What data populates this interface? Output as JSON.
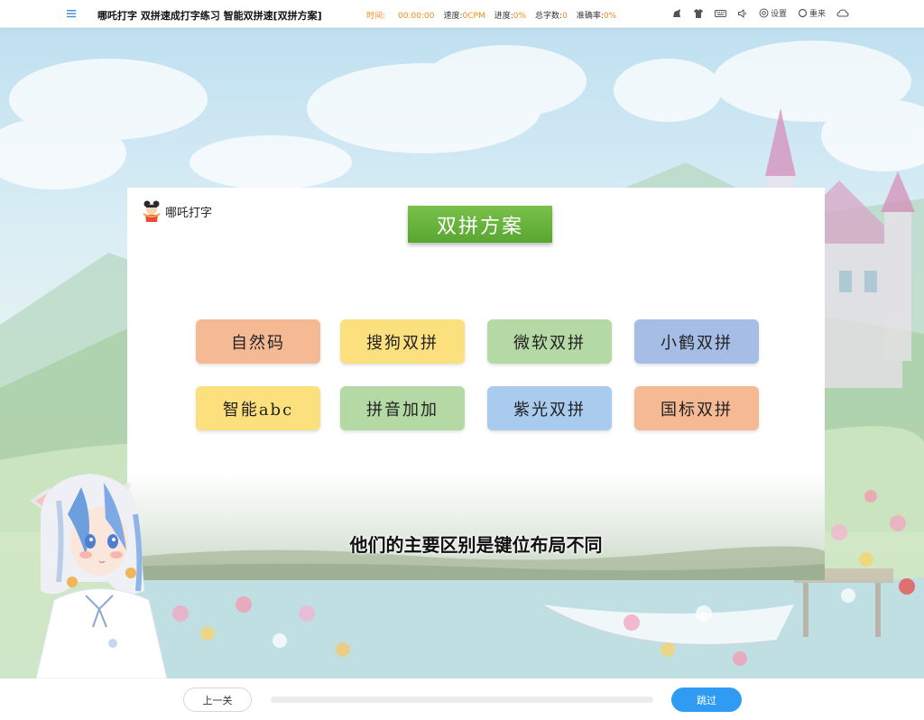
{
  "topbar": {
    "title": "哪吒打字 双拼速成打字练习 智能双拼速[双拼方案]",
    "time_label": "时间:",
    "time_value": "00:00:00",
    "speed_label": "速度:",
    "speed_value": "0CPM",
    "progress_label": "进度:",
    "progress_value": "0%",
    "total_label": "总字数:",
    "total_value": "0",
    "accuracy_label": "准确率:",
    "accuracy_value": "0%",
    "settings_label": "设置",
    "restart_label": "重来"
  },
  "card": {
    "logo_text": "哪吒打字",
    "heading": "双拼方案",
    "options": [
      {
        "label": "自然码",
        "color": "#f5b994"
      },
      {
        "label": "搜狗双拼",
        "color": "#fde07e"
      },
      {
        "label": "微软双拼",
        "color": "#b5d9a4"
      },
      {
        "label": "小鹤双拼",
        "color": "#a6bde6"
      },
      {
        "label": "智能abc",
        "color": "#fde07e"
      },
      {
        "label": "拼音加加",
        "color": "#b5d9a4"
      },
      {
        "label": "紫光双拼",
        "color": "#a8cbee"
      },
      {
        "label": "国标双拼",
        "color": "#f5b994"
      }
    ],
    "subtitle": "他们的主要区别是键位布局不同"
  },
  "bottombar": {
    "prev_label": "上一关",
    "skip_label": "跳过",
    "progress_fraction": 0
  },
  "colors": {
    "accent_orange": "#f08a1c",
    "primary_blue": "#2f9bf3",
    "heading_green": "#58a632"
  }
}
